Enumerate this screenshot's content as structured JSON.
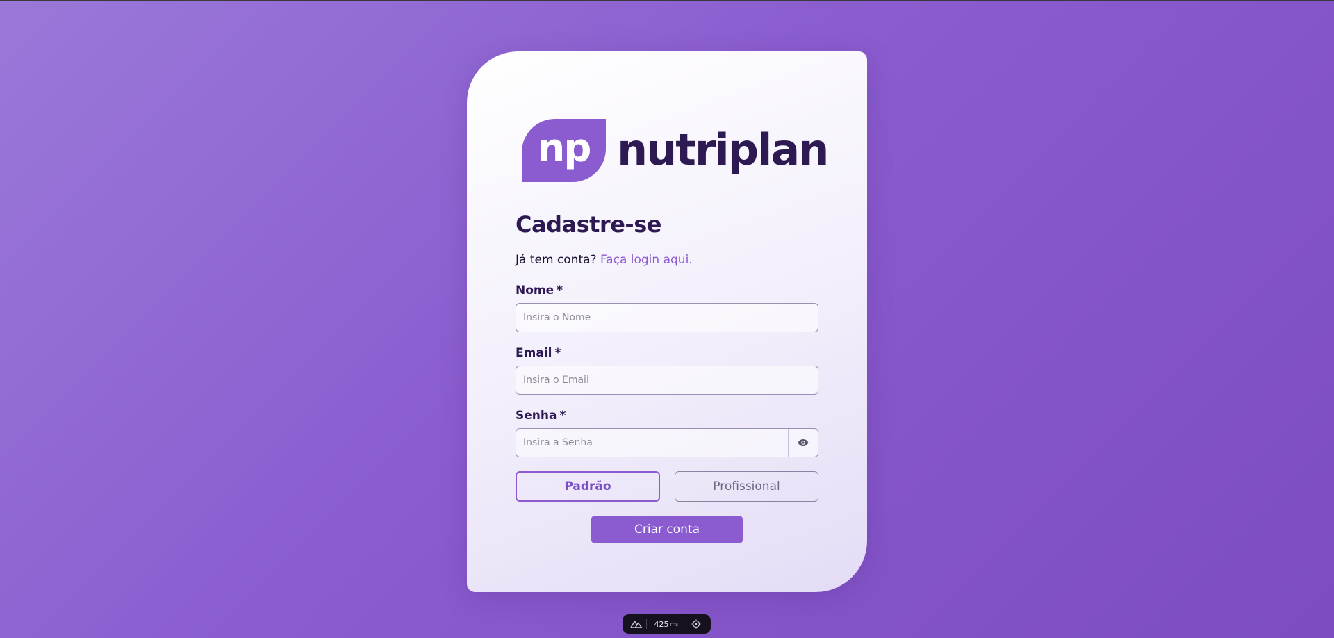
{
  "brand": {
    "mark_text": "np",
    "wordmark": "nutriplan",
    "accent_color": "#8a5ccf",
    "dark_color": "#2e1a52"
  },
  "form": {
    "title": "Cadastre-se",
    "login_prompt": "Já tem conta?",
    "login_link": "Faça login aqui.",
    "required_marker": "*",
    "fields": {
      "name": {
        "label": "Nome",
        "placeholder": "Insira o Nome",
        "value": ""
      },
      "email": {
        "label": "Email",
        "placeholder": "Insira o Email",
        "value": ""
      },
      "password": {
        "label": "Senha",
        "placeholder": "Insira a Senha",
        "value": "",
        "toggle_icon": "eye-icon"
      }
    },
    "account_types": {
      "standard_label": "Padrão",
      "professional_label": "Profissional",
      "selected": "Padrão"
    },
    "submit_label": "Criar conta"
  },
  "devtools": {
    "logo_icon": "nuxt-icon",
    "timing_value": "425",
    "timing_unit": "ms",
    "inspect_icon": "crosshair-icon"
  }
}
